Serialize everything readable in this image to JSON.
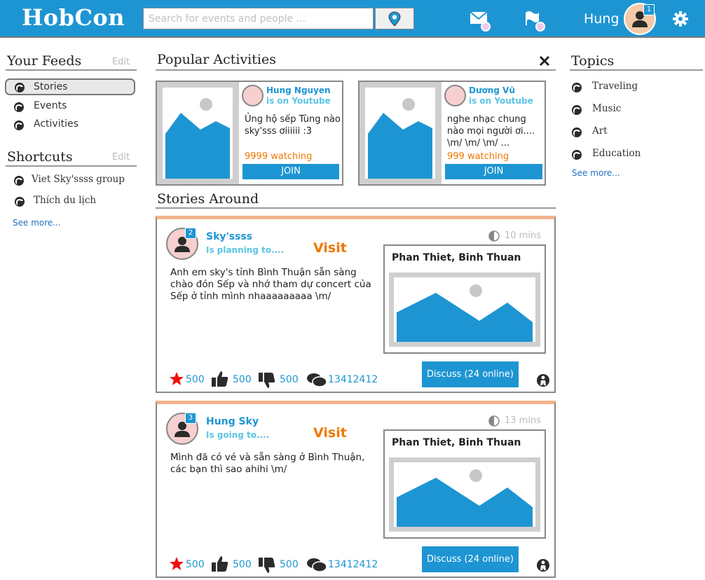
{
  "header": {
    "logo": "HobCon",
    "search_placeholder": "Search for events and people ...",
    "username": "Hung",
    "avatar_badge": "1"
  },
  "left": {
    "feeds_title": "Your Feeds",
    "feeds_edit": "Edit",
    "feeds": [
      {
        "label": "Stories",
        "selected": true
      },
      {
        "label": "Events"
      },
      {
        "label": "Activities"
      }
    ],
    "shortcuts_title": "Shortcuts",
    "shortcuts_edit": "Edit",
    "shortcuts": [
      {
        "label": "Viet Sky'ssss group"
      },
      {
        "label": "Thích du lịch"
      }
    ],
    "see_more": "See more..."
  },
  "popular": {
    "title": "Popular Activities",
    "cards": [
      {
        "name": "Hung Nguyen",
        "sub": "is on Youtube",
        "text": "Ủng hộ sếp Tùng nào sky'sss ơiiiiii :3",
        "watching": "9999 watching",
        "join": "JOIN"
      },
      {
        "name": "Dương Vũ",
        "sub": "is on Youtube",
        "text": "nghe nhạc chung nào mọi người ơi.... \\m/ \\m/ \\m/ ...",
        "watching": "999 watching",
        "join": "JOIN"
      }
    ]
  },
  "stories": {
    "title": "Stories Around",
    "items": [
      {
        "badge": "2",
        "name": "Sky'ssss",
        "sub": "Is planning to....",
        "visit": "Visit",
        "time": "10 mins",
        "text": "Anh em sky's tỉnh Bình Thuận sẵn sàng chào đón Sếp và nhớ tham dự concert của Sếp ở tỉnh mình nhaaaaaaaaa \\m/",
        "place": "Phan Thiet, Binh Thuan",
        "stars": "500",
        "likes": "500",
        "dislikes": "500",
        "comments": "13412412",
        "discuss": "Discuss (24 online)"
      },
      {
        "badge": "3",
        "name": "Hung Sky",
        "sub": "Is going to....",
        "visit": "Visit",
        "time": "13 mins",
        "text": "Mình đã có vé và sẵn sàng ở Bình Thuận, các bạn thì sao ahihi \\m/",
        "place": "Phan Thiet, Binh Thuan",
        "stars": "500",
        "likes": "500",
        "dislikes": "500",
        "comments": "13412412",
        "discuss": "Discuss (24 online)"
      }
    ]
  },
  "topics": {
    "title": "Topics",
    "items": [
      {
        "label": "Traveling"
      },
      {
        "label": "Music"
      },
      {
        "label": "Art"
      },
      {
        "label": "Education"
      }
    ],
    "see_more": "See more..."
  },
  "colors": {
    "brand": "#1e95d3",
    "accent": "#f07800",
    "star": "#ee1111",
    "story_top": "#f4b28a"
  },
  "icons": [
    "location-pin-icon",
    "mail-icon",
    "flag-icon",
    "gear-icon",
    "close-icon",
    "user-head-icon",
    "contrast-clock-icon",
    "star-icon",
    "thumbs-up-icon",
    "thumbs-down-icon",
    "chat-icon",
    "person-icon"
  ]
}
